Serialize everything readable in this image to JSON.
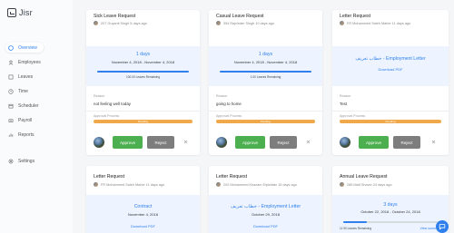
{
  "app": {
    "logo_text": "Jisr"
  },
  "sidebar": {
    "items": [
      {
        "label": "Overview",
        "icon": "overview-icon"
      },
      {
        "label": "Employees",
        "icon": "employees-icon"
      },
      {
        "label": "Leaves",
        "icon": "leaves-icon"
      },
      {
        "label": "Time",
        "icon": "time-icon"
      },
      {
        "label": "Scheduler",
        "icon": "scheduler-icon"
      },
      {
        "label": "Payroll",
        "icon": "payroll-icon"
      },
      {
        "label": "Reports",
        "icon": "reports-icon"
      },
      {
        "label": "Settings",
        "icon": "settings-icon"
      }
    ]
  },
  "cards": [
    {
      "title": "Sick Leave Request",
      "meta": "207 Guyanti Singh 5 days ago",
      "band_title": "1 days",
      "band_date": "November 4, 2018 - November 4, 2018",
      "progress": 1.0,
      "progress_label": "100.00 Leaves Remaining",
      "reason_label": "Reason",
      "reason": "not feeling well today",
      "approval_label": "Approval Process",
      "approval_status": "Pending",
      "approve": "Approve",
      "reject": "Reject"
    },
    {
      "title": "Casual Leave Request",
      "meta": "354 Rajvinder Singh 10 days ago",
      "band_title": "1 days",
      "band_date": "November 4, 2018 - November 4, 2018",
      "progress": 1.0,
      "progress_label": "1.00 Leaves Remaining",
      "reason_label": "Reason",
      "reason": "going to home",
      "approval_label": "Approval Process",
      "approval_status": "Pending",
      "approve": "Approve",
      "reject": "Reject"
    },
    {
      "title": "Letter Request",
      "meta": "FR Mohammed Saleh Maher 11 days ago",
      "band_title": "خطاب تعريف - Employment Letter",
      "pdf": "Download PDF",
      "reason_label": "Reason",
      "reason": "Test",
      "approval_label": "Approval Process",
      "approval_status": "Pending",
      "approve": "Approve",
      "reject": "Reject"
    },
    {
      "title": "Letter Request",
      "meta": "FR Mohammed Saleh Maher 11 days ago",
      "band_title": "Contract",
      "band_date": "November 4, 2018",
      "pdf": "Download PDF"
    },
    {
      "title": "Letter Request",
      "meta": "202 Mohammed Khazam Elpishtan 15 days ago",
      "band_title": "خطاب تعريف - Employment Letter",
      "band_date": "October 29, 2018",
      "pdf": "Download PDF"
    },
    {
      "title": "Annual Leave Request",
      "meta": "285 Matt Shaver 24 days ago",
      "band_title": "3 days",
      "band_date": "October 22, 2018 - October 24, 2018",
      "progress": 0.25,
      "progress_label": "11.90 Leaves Remaining",
      "view_summary": "View summary"
    }
  ]
}
